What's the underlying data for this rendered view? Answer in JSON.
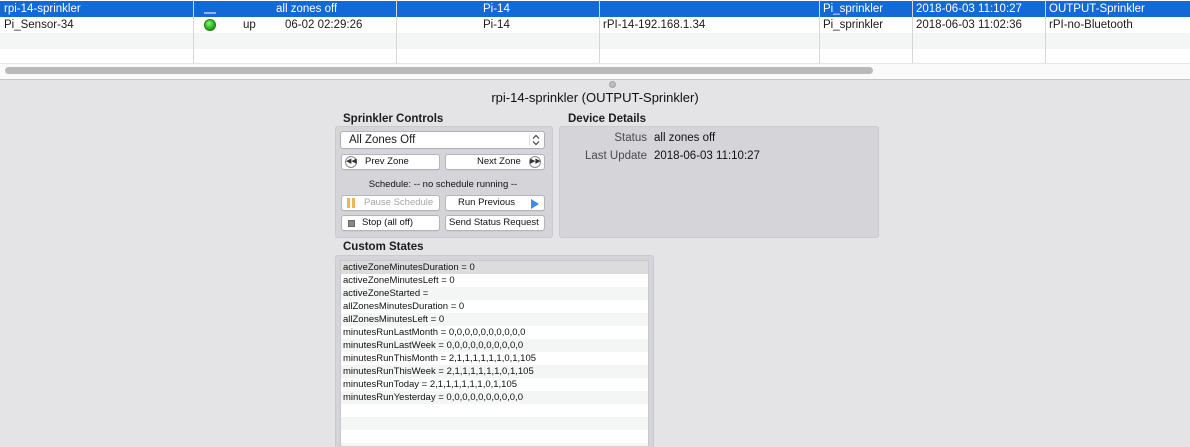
{
  "devices": {
    "rows": [
      {
        "name": "rpi-14-sprinkler",
        "state_icon": "dash",
        "status_text": "",
        "state": "all zones off",
        "folder": "Pi-14",
        "address": "",
        "model": "Pi_sprinkler",
        "last_changed": "2018-06-03 11:10:27",
        "type": "OUTPUT-Sprinkler",
        "selected": true
      },
      {
        "name": "Pi_Sensor-34",
        "state_icon": "green-dot",
        "status_text": "up",
        "state": "06-02 02:29:26",
        "folder": "Pi-14",
        "address": "rPI-14-192.168.1.34",
        "model": "Pi_sprinkler",
        "last_changed": "2018-06-03 11:02:36",
        "type": "rPI-no-Bluetooth",
        "selected": false
      }
    ]
  },
  "device_title": "rpi-14-sprinkler (OUTPUT-Sprinkler)",
  "sprinkler_controls": {
    "title": "Sprinkler Controls",
    "zone_select_value": "All Zones Off",
    "prev_zone": "Prev Zone",
    "next_zone": "Next Zone",
    "schedule_text": "Schedule: -- no schedule running --",
    "pause_schedule": "Pause Schedule",
    "run_previous": "Run Previous",
    "stop_all": "Stop (all off)",
    "send_status": "Send Status Request"
  },
  "device_details": {
    "title": "Device Details",
    "status_label": "Status",
    "status_value": "all zones off",
    "last_update_label": "Last Update",
    "last_update_value": "2018-06-03 11:10:27"
  },
  "custom_states": {
    "title": "Custom States",
    "items": [
      "activeZoneMinutesDuration = 0",
      "activeZoneMinutesLeft = 0",
      "activeZoneStarted = ",
      "allZonesMinutesDuration = 0",
      "allZonesMinutesLeft = 0",
      "minutesRunLastMonth = 0,0,0,0,0,0,0,0,0,0",
      "minutesRunLastWeek = 0,0,0,0,0,0,0,0,0,0",
      "minutesRunThisMonth = 2,1,1,1,1,1,1,0,1,105",
      "minutesRunThisWeek = 2,1,1,1,1,1,1,0,1,105",
      "minutesRunToday = 2,1,1,1,1,1,1,0,1,105",
      "minutesRunYesterday = 0,0,0,0,0,0,0,0,0,0"
    ]
  },
  "colors": {
    "selection": "#1369d5",
    "window_bg": "#e4e3e6",
    "panel_bg": "#d5d4d9",
    "status_green": "#2db51e",
    "play_blue": "#3d8de6",
    "pause_orange": "#f0b55b"
  }
}
